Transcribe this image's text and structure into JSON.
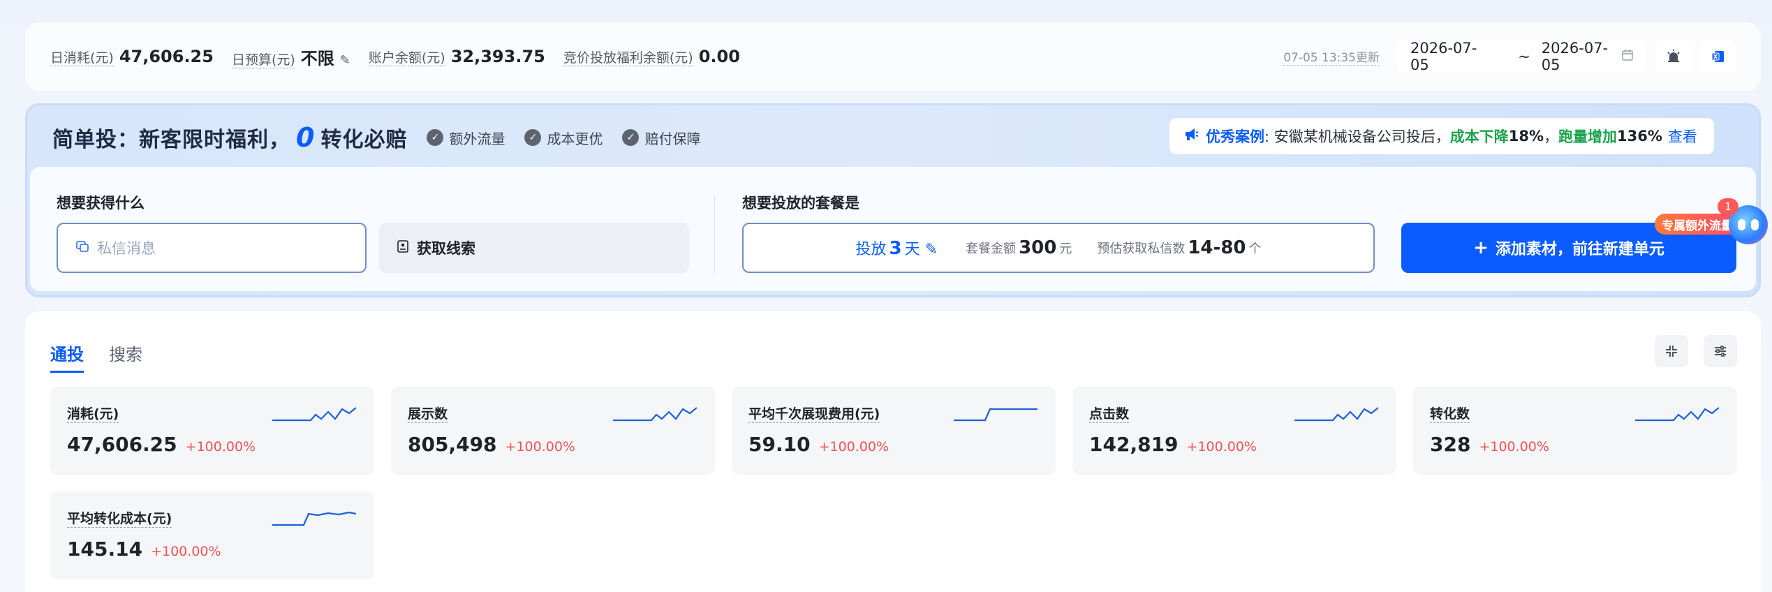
{
  "topbar": {
    "daily_cost_label": "日消耗(元)",
    "daily_cost_value": "47,606.25",
    "daily_budget_label": "日预算(元)",
    "daily_budget_value": "不限",
    "edit_icon": "✎",
    "balance_label": "账户余额(元)",
    "balance_value": "32,393.75",
    "welfare_label": "竞价投放福利余额(元)",
    "welfare_value": "0.00",
    "update_time": "07-05 13:35更新",
    "date_start": "2026-07-05",
    "date_sep": "~",
    "date_end": "2026-07-05"
  },
  "promo": {
    "title_prefix": "简单投：新客限时福利，",
    "title_zero": "0",
    "title_suffix": "转化必赔",
    "badges": [
      "额外流量",
      "成本更优",
      "赔付保障"
    ],
    "case_label": "优秀案例",
    "case_text": ": 安徽某机械设备公司投后，",
    "case_cost_label": "成本下降",
    "case_cost_value": "18%",
    "case_comma": "，",
    "case_volume_label": "跑量增加",
    "case_volume_value": "136%",
    "case_link": "查看",
    "goal_title": "想要获得什么",
    "goal_private": "私信消息",
    "goal_clue": "获取线索",
    "package_title": "想要投放的套餐是",
    "package_days_prefix": "投放",
    "package_days": "3",
    "package_days_unit": "天",
    "package_amount_label": "套餐金额",
    "package_amount": "300",
    "package_amount_unit": "元",
    "package_est_label": "预估获取私信数",
    "package_est": "14-80",
    "package_est_unit": "个",
    "create_button": "添加素材，前往新建单元",
    "float_tag": "专属额外流量",
    "float_count": "1"
  },
  "tabs": [
    "通投",
    "搜索"
  ],
  "cards": [
    {
      "label": "消耗(元)",
      "value": "47,606.25",
      "change": "+100.00%"
    },
    {
      "label": "展示数",
      "value": "805,498",
      "change": "+100.00%"
    },
    {
      "label": "平均千次展现费用(元)",
      "value": "59.10",
      "change": "+100.00%"
    },
    {
      "label": "点击数",
      "value": "142,819",
      "change": "+100.00%"
    },
    {
      "label": "转化数",
      "value": "328",
      "change": "+100.00%"
    },
    {
      "label": "平均转化成本(元)",
      "value": "145.14",
      "change": "+100.00%"
    }
  ],
  "colors": {
    "accent": "#0b5cff",
    "positive_change": "#f05353",
    "case_green": "#1aa34a"
  },
  "icons": {
    "calendar": "calendar-icon",
    "bug": "bug-icon",
    "report": "report-icon",
    "check": "check-circle-icon",
    "megaphone": "megaphone-icon",
    "collapse": "collapse-icon",
    "settings": "settings-sliders-icon"
  }
}
